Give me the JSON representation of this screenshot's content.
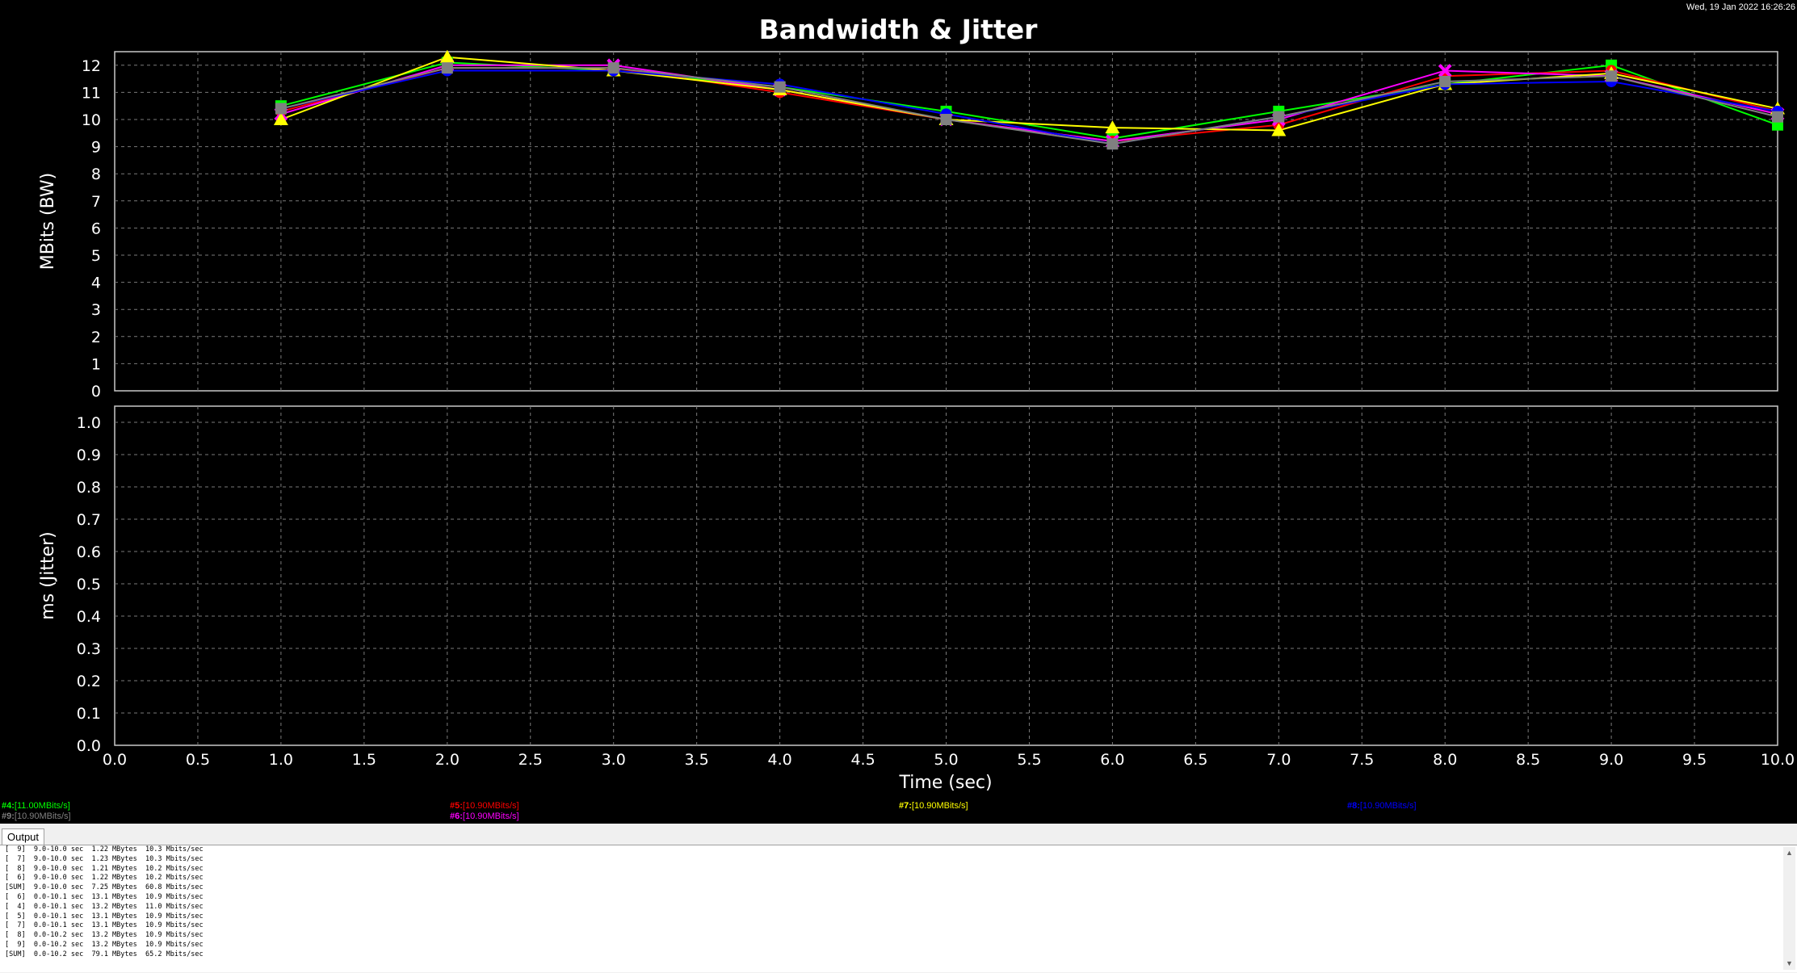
{
  "timestamp": "Wed, 19 Jan 2022 16:26:26",
  "chart_data": {
    "title": "Bandwidth & Jitter",
    "panels": [
      {
        "type": "line",
        "ylabel": "MBits (BW)",
        "ylim": [
          0,
          12.5
        ],
        "yticks": [
          0,
          1,
          2,
          3,
          4,
          5,
          6,
          7,
          8,
          9,
          10,
          11,
          12
        ],
        "series": [
          {
            "name": "#4",
            "color": "#00ff00",
            "marker": "square",
            "x": [
              1,
              2,
              3,
              4,
              5,
              6,
              7,
              8,
              9,
              10
            ],
            "values": [
              10.5,
              12.1,
              11.8,
              11.2,
              10.3,
              9.3,
              10.3,
              11.3,
              12.0,
              9.8
            ]
          },
          {
            "name": "#5",
            "color": "#ff0000",
            "marker": "circle",
            "x": [
              1,
              2,
              3,
              4,
              5,
              6,
              7,
              8,
              9,
              10
            ],
            "values": [
              10.3,
              11.9,
              11.9,
              11.0,
              10.0,
              9.2,
              9.8,
              11.6,
              11.8,
              10.3
            ]
          },
          {
            "name": "#6",
            "color": "#ff00ff",
            "marker": "x",
            "x": [
              1,
              2,
              3,
              4,
              5,
              6,
              7,
              8,
              9,
              10
            ],
            "values": [
              10.2,
              12.0,
              12.0,
              11.1,
              10.0,
              9.2,
              10.0,
              11.8,
              11.6,
              10.2
            ]
          },
          {
            "name": "#7",
            "color": "#ffff00",
            "marker": "triangle",
            "x": [
              1,
              2,
              3,
              4,
              5,
              6,
              7,
              8,
              9,
              10
            ],
            "values": [
              10.0,
              12.3,
              11.8,
              11.1,
              10.0,
              9.7,
              9.6,
              11.3,
              11.7,
              10.4
            ]
          },
          {
            "name": "#8",
            "color": "#0000ff",
            "marker": "circle",
            "x": [
              1,
              2,
              3,
              4,
              5,
              6,
              7,
              8,
              9,
              10
            ],
            "values": [
              10.4,
              11.8,
              11.8,
              11.3,
              10.2,
              9.1,
              10.1,
              11.3,
              11.4,
              10.3
            ]
          },
          {
            "name": "#9",
            "color": "#808080",
            "marker": "square",
            "x": [
              1,
              2,
              3,
              4,
              5,
              6,
              7,
              8,
              9,
              10
            ],
            "values": [
              10.4,
              11.9,
              11.9,
              11.2,
              10.0,
              9.1,
              10.1,
              11.4,
              11.6,
              10.1
            ]
          }
        ]
      },
      {
        "type": "line",
        "ylabel": "ms (Jitter)",
        "ylim": [
          0,
          1.05
        ],
        "yticks": [
          0.0,
          0.1,
          0.2,
          0.3,
          0.4,
          0.5,
          0.6,
          0.7,
          0.8,
          0.9,
          1.0
        ],
        "series": []
      }
    ],
    "xlabel": "Time (sec)",
    "xlim": [
      0,
      10
    ],
    "xticks": [
      0.0,
      0.5,
      1.0,
      1.5,
      2.0,
      2.5,
      3.0,
      3.5,
      4.0,
      4.5,
      5.0,
      5.5,
      6.0,
      6.5,
      7.0,
      7.5,
      8.0,
      8.5,
      9.0,
      9.5,
      10.0
    ],
    "grid": true,
    "legend_placement": "bottom"
  },
  "legend": [
    {
      "id": "#4:",
      "value": "[11.00MBits/s]",
      "color": "#00ff00"
    },
    {
      "id": "#5:",
      "value": "[10.90MBits/s]",
      "color": "#ff0000"
    },
    {
      "id": "#7:",
      "value": "[10.90MBits/s]",
      "color": "#ffff00"
    },
    {
      "id": "#8:",
      "value": "[10.90MBits/s]",
      "color": "#0000ff"
    },
    {
      "id": "#9:",
      "value": "[10.90MBits/s]",
      "color": "#808080"
    },
    {
      "id": "#6:",
      "value": "[10.90MBits/s]",
      "color": "#ff00ff"
    }
  ],
  "output": {
    "tab_label": "Output",
    "lines": [
      "[  9]  9.0-10.0 sec  1.22 MBytes  10.3 Mbits/sec",
      "[  7]  9.0-10.0 sec  1.23 MBytes  10.3 Mbits/sec",
      "[  8]  9.0-10.0 sec  1.21 MBytes  10.2 Mbits/sec",
      "[  6]  9.0-10.0 sec  1.22 MBytes  10.2 Mbits/sec",
      "[SUM]  9.0-10.0 sec  7.25 MBytes  60.8 Mbits/sec",
      "[  6]  0.0-10.1 sec  13.1 MBytes  10.9 Mbits/sec",
      "[  4]  0.0-10.1 sec  13.2 MBytes  11.0 Mbits/sec",
      "[  5]  0.0-10.1 sec  13.1 MBytes  10.9 Mbits/sec",
      "[  7]  0.0-10.1 sec  13.1 MBytes  10.9 Mbits/sec",
      "[  8]  0.0-10.2 sec  13.2 MBytes  10.9 Mbits/sec",
      "[  9]  0.0-10.2 sec  13.2 MBytes  10.9 Mbits/sec",
      "[SUM]  0.0-10.2 sec  79.1 MBytes  65.2 Mbits/sec"
    ]
  }
}
